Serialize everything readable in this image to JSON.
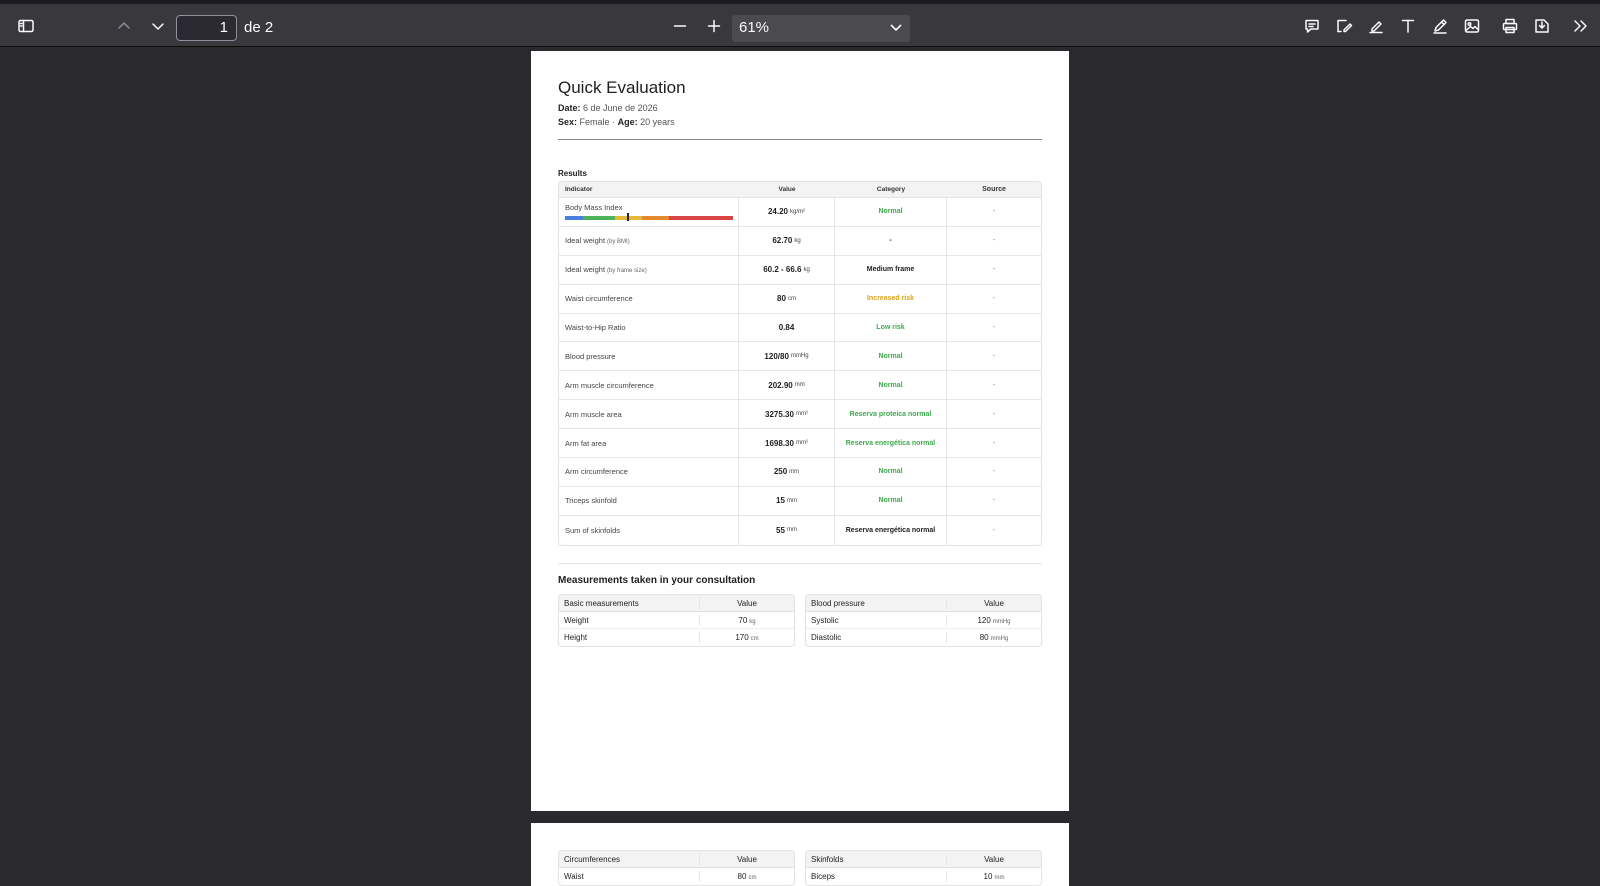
{
  "toolbar": {
    "page_number": "1",
    "page_of": "de 2",
    "zoom": "61%"
  },
  "report": {
    "title": "Quick Evaluation",
    "date_label": "Date:",
    "date_value": "6 de June de 2026",
    "sex_label": "Sex:",
    "sex_value": "Female",
    "sep": "·",
    "age_label": "Age:",
    "age_value": "20 years",
    "results_label": "Results",
    "columns": [
      "Indicator",
      "Value",
      "Category",
      "Source"
    ],
    "bmi": {
      "value": 24.2,
      "scale_min": 15,
      "scale_max": 40,
      "segments": [
        {
          "color": "#4a7fe0"
        },
        {
          "color": "#4db35a"
        },
        {
          "color": "#e6b83a"
        },
        {
          "color": "#e48a2e"
        },
        {
          "color": "#d94545"
        },
        {
          "color": "#d94545"
        }
      ]
    },
    "rows": [
      {
        "indicator": "Body Mass Index",
        "note": "",
        "value": "24.20",
        "unit": "kg/m²",
        "category": "Normal",
        "cat_color": "green",
        "source": "-"
      },
      {
        "indicator": "Ideal weight",
        "note": "(by BMI)",
        "value": "62.70",
        "unit": "kg",
        "category": "-",
        "cat_color": "dark",
        "source": "-"
      },
      {
        "indicator": "Ideal weight",
        "note": "(by frame size)",
        "value": "60.2 - 66.6",
        "unit": "kg",
        "category": "Medium frame",
        "cat_color": "dark",
        "source": "-"
      },
      {
        "indicator": "Waist circumference",
        "note": "",
        "value": "80",
        "unit": "cm",
        "category": "Increased risk",
        "cat_color": "amber",
        "source": "-"
      },
      {
        "indicator": "Waist-to-Hip Ratio",
        "note": "",
        "value": "0.84",
        "unit": "",
        "category": "Low risk",
        "cat_color": "green",
        "source": "-"
      },
      {
        "indicator": "Blood pressure",
        "note": "",
        "value": "120/80",
        "unit": "mmHg",
        "category": "Normal",
        "cat_color": "green",
        "source": "-"
      },
      {
        "indicator": "Arm muscle circumference",
        "note": "",
        "value": "202.90",
        "unit": "mm",
        "category": "Normal",
        "cat_color": "green",
        "source": "-"
      },
      {
        "indicator": "Arm muscle area",
        "note": "",
        "value": "3275.30",
        "unit": "mm²",
        "category": "Reserva proteica normal",
        "cat_color": "green",
        "source": "-"
      },
      {
        "indicator": "Arm fat area",
        "note": "",
        "value": "1698.30",
        "unit": "mm²",
        "category": "Reserva energética normal",
        "cat_color": "green",
        "source": "-"
      },
      {
        "indicator": "Arm circumference",
        "note": "",
        "value": "250",
        "unit": "mm",
        "category": "Normal",
        "cat_color": "green",
        "source": "-"
      },
      {
        "indicator": "Triceps skinfold",
        "note": "",
        "value": "15",
        "unit": "mm",
        "category": "Normal",
        "cat_color": "green",
        "source": "-"
      },
      {
        "indicator": "Sum of skinfolds",
        "note": "",
        "value": "55",
        "unit": "mm",
        "category": "Reserva energética normal",
        "cat_color": "dark",
        "source": "-"
      }
    ],
    "measurements_title": "Measurements taken in your consultation",
    "basic": {
      "header": "Basic measurements",
      "value_header": "Value",
      "rows": [
        {
          "label": "Weight",
          "value": "70",
          "unit": "kg"
        },
        {
          "label": "Height",
          "value": "170",
          "unit": "cm"
        }
      ]
    },
    "bp": {
      "header": "Blood pressure",
      "value_header": "Value",
      "rows": [
        {
          "label": "Systolic",
          "value": "120",
          "unit": "mmHg"
        },
        {
          "label": "Diastolic",
          "value": "80",
          "unit": "mmHg"
        }
      ]
    }
  },
  "page2": {
    "circ": {
      "header": "Circumferences",
      "value_header": "Value",
      "rows": [
        {
          "label": "Waist",
          "value": "80",
          "unit": "cm"
        }
      ]
    },
    "skin": {
      "header": "Skinfolds",
      "value_header": "Value",
      "rows": [
        {
          "label": "Biceps",
          "value": "10",
          "unit": "mm"
        }
      ]
    }
  }
}
